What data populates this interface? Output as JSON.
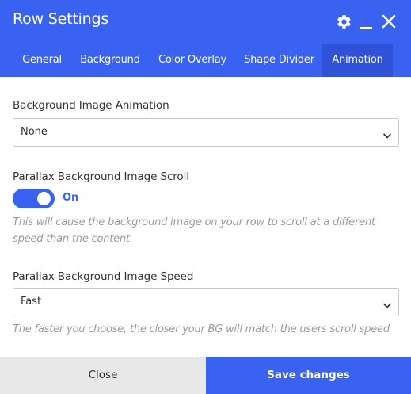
{
  "header": {
    "title": "Row Settings",
    "icons": [
      "gear-icon",
      "minimize-icon",
      "close-icon"
    ],
    "accent_color": "#3a62f0",
    "active_tab_color": "#2f52d6"
  },
  "tabs": [
    {
      "label": "General",
      "active": false
    },
    {
      "label": "Background",
      "active": false
    },
    {
      "label": "Color Overlay",
      "active": false
    },
    {
      "label": "Shape Divider",
      "active": false
    },
    {
      "label": "Animation",
      "active": true
    }
  ],
  "form": {
    "bg_animation": {
      "label": "Background Image Animation",
      "value": "None"
    },
    "parallax_scroll": {
      "label": "Parallax Background Image Scroll",
      "toggle_state": "On",
      "help": "This will cause the background image on your row to scroll at a different speed than the content"
    },
    "parallax_speed": {
      "label": "Parallax Background Image Speed",
      "value": "Fast",
      "help": "The faster you choose, the closer your BG will match the users scroll speed"
    }
  },
  "footer": {
    "close_label": "Close",
    "save_label": "Save changes"
  }
}
